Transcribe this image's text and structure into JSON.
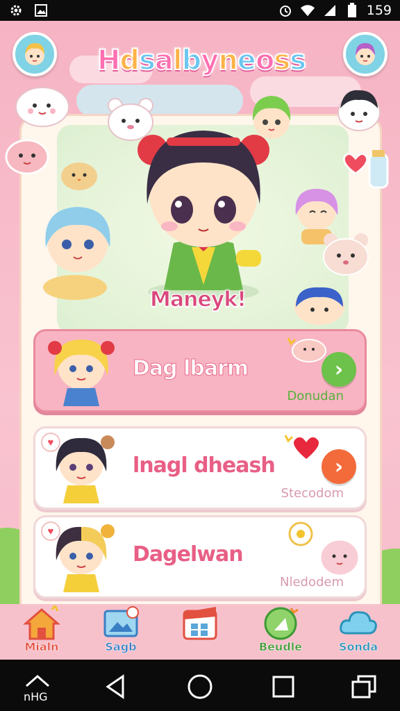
{
  "status_bar": {
    "time": "159",
    "icons": [
      "settings-gear-icon",
      "image-icon",
      "alarm-icon",
      "wifi-icon",
      "signal-icon",
      "battery-icon"
    ]
  },
  "app": {
    "title": "Hdsalbyneoss",
    "hero_label": "Maneyk!",
    "accent_pink": "#ff6fb1",
    "accent_green": "#6cc24a",
    "accent_orange": "#f36b3a"
  },
  "cards": [
    {
      "title": "Dag lbarm",
      "sub": "Donudan",
      "button_icon": "chevron-right-icon",
      "button_color": "#6cc24a",
      "sub_color": "#58b03a",
      "active": true
    },
    {
      "title": "lnagl dheash",
      "sub": "Stecodom",
      "button_icon": "chevron-right-icon",
      "button_color": "#f36b3a",
      "sub_color": "#d79ab0",
      "active": false
    },
    {
      "title": "Dagelwan",
      "sub": "Nledodem",
      "button_icon": "",
      "button_color": "",
      "sub_color": "#d79ab0",
      "active": false
    }
  ],
  "bottom_nav": [
    {
      "label": "Mialn",
      "icon": "home-icon",
      "color": "#e2503f"
    },
    {
      "label": "Sagb",
      "icon": "picture-frame-icon",
      "color": "#3a7fc4"
    },
    {
      "label": "",
      "icon": "calendar-icon",
      "color": "#e2503f"
    },
    {
      "label": "Beudle",
      "icon": "leaf-badge-icon",
      "color": "#3d9a33"
    },
    {
      "label": "Sonda",
      "icon": "cloud-icon",
      "color": "#2a93b8"
    }
  ],
  "system_nav": {
    "caption": "nHG",
    "buttons": [
      "home-outline-icon",
      "back-icon",
      "home-circle-icon",
      "recents-icon",
      "recent-apps-icon"
    ]
  }
}
